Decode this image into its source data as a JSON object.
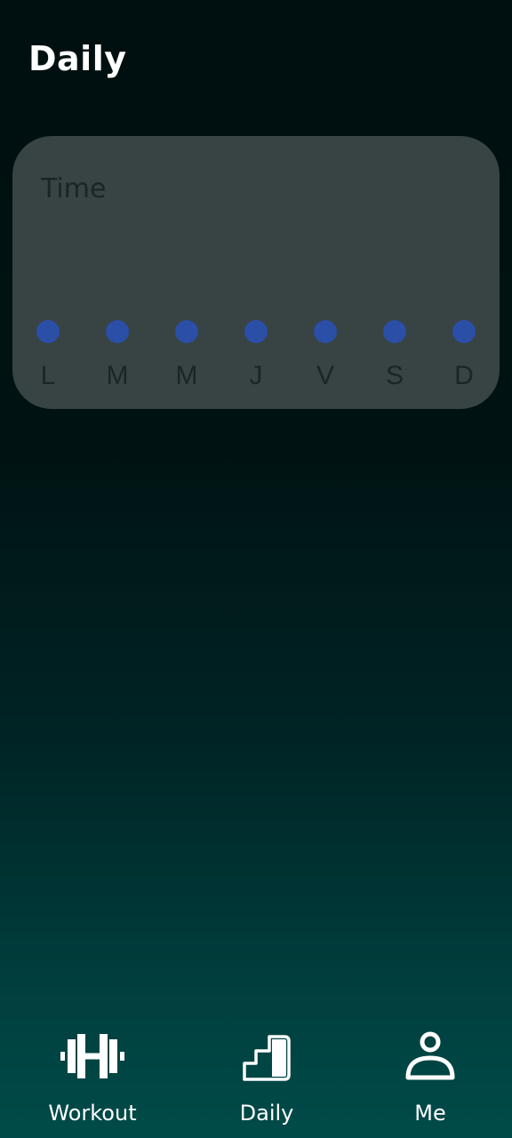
{
  "header": {
    "title": "Daily"
  },
  "card": {
    "label": "Time",
    "days": [
      {
        "letter": "L"
      },
      {
        "letter": "M"
      },
      {
        "letter": "M"
      },
      {
        "letter": "J"
      },
      {
        "letter": "V"
      },
      {
        "letter": "S"
      },
      {
        "letter": "D"
      }
    ],
    "dot_color": "#2b4ea7"
  },
  "nav": {
    "items": [
      {
        "label": "Workout",
        "icon": "dumbbell-icon"
      },
      {
        "label": "Daily",
        "icon": "steps-chart-icon"
      },
      {
        "label": "Me",
        "icon": "person-icon"
      }
    ]
  },
  "colors": {
    "card_background": "#384343",
    "card_text": "#1c2525",
    "background_top": "#000f10",
    "background_bottom": "#004b49"
  }
}
